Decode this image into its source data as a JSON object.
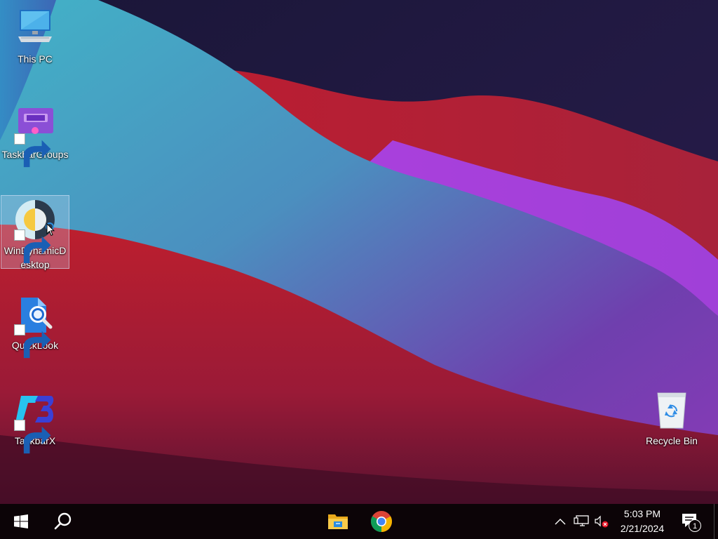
{
  "desktop": {
    "icons": [
      {
        "label": "This PC",
        "icon": "computer-icon"
      },
      {
        "label": "TaskbarGroups",
        "icon": "taskbar-groups-icon",
        "shortcut": true
      },
      {
        "label": "WinDynamicDesktop",
        "icon": "win-dynamic-desktop-icon",
        "shortcut": true,
        "selected": true
      },
      {
        "label": "QuickLook",
        "icon": "quicklook-icon",
        "shortcut": true
      },
      {
        "label": "TaskbarX",
        "icon": "taskbarx-icon",
        "shortcut": true
      },
      {
        "label": "Recycle Bin",
        "icon": "recycle-bin-icon"
      }
    ]
  },
  "taskbar": {
    "start_icon": "windows-start-icon",
    "search_icon": "search-icon",
    "pinned": [
      {
        "name": "File Explorer",
        "icon": "file-explorer-icon"
      },
      {
        "name": "Google Chrome",
        "icon": "chrome-icon"
      }
    ],
    "tray": {
      "overflow_icon": "chevron-up-icon",
      "network_icon": "network-icon",
      "volume_icon": "volume-muted-icon"
    },
    "clock": {
      "time": "5:03 PM",
      "date": "2/21/2024"
    },
    "notifications": {
      "icon": "action-center-icon",
      "count": "1"
    }
  },
  "colors": {
    "taskbar": "#0c0407",
    "wallpaper_dark": "#1c1741",
    "wallpaper_red": "#c1202f",
    "wallpaper_teal": "#3fa3c0",
    "wallpaper_purple": "#a33cd4"
  }
}
